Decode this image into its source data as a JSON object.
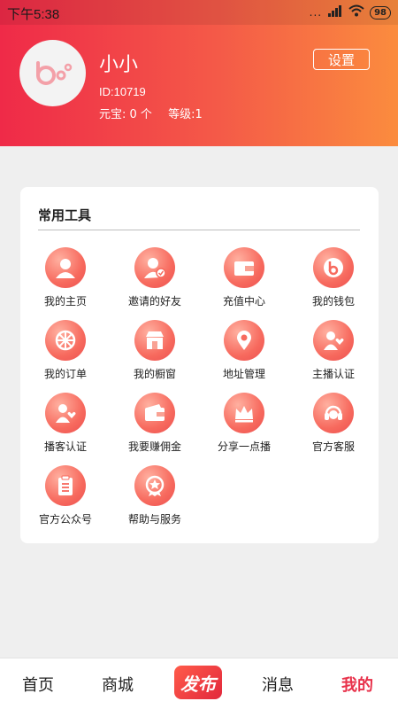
{
  "status_bar": {
    "time": "下午5:38",
    "dots": "...",
    "battery": "98"
  },
  "profile": {
    "username": "小小",
    "id": "ID:10719",
    "yuanbao": "元宝: 0 个",
    "level": "等级:1",
    "settings_label": "设置",
    "avatar_icon": "brand-logo-icon"
  },
  "tools": {
    "title": "常用工具",
    "items": [
      {
        "label": "我的主页",
        "icon": "person-icon"
      },
      {
        "label": "邀请的好友",
        "icon": "invite-friend-icon"
      },
      {
        "label": "充值中心",
        "icon": "wallet-card-icon"
      },
      {
        "label": "我的钱包",
        "icon": "brand-coin-icon"
      },
      {
        "label": "我的订单",
        "icon": "wheel-icon"
      },
      {
        "label": "我的橱窗",
        "icon": "storefront-icon"
      },
      {
        "label": "地址管理",
        "icon": "location-pin-icon"
      },
      {
        "label": "主播认证",
        "icon": "anchor-verify-icon"
      },
      {
        "label": "播客认证",
        "icon": "podcaster-verify-icon"
      },
      {
        "label": "我要赚佣金",
        "icon": "commission-wallet-icon"
      },
      {
        "label": "分享一点播",
        "icon": "crown-icon"
      },
      {
        "label": "官方客服",
        "icon": "headset-icon"
      },
      {
        "label": "官方公众号",
        "icon": "clipboard-icon"
      },
      {
        "label": "帮助与服务",
        "icon": "star-badge-icon"
      }
    ]
  },
  "nav": {
    "home": "首页",
    "mall": "商城",
    "publish": "发布",
    "messages": "消息",
    "mine": "我的"
  },
  "colors": {
    "accent": "#e8324b",
    "header_start": "#ef2a48",
    "header_end": "#fb8c3e"
  }
}
